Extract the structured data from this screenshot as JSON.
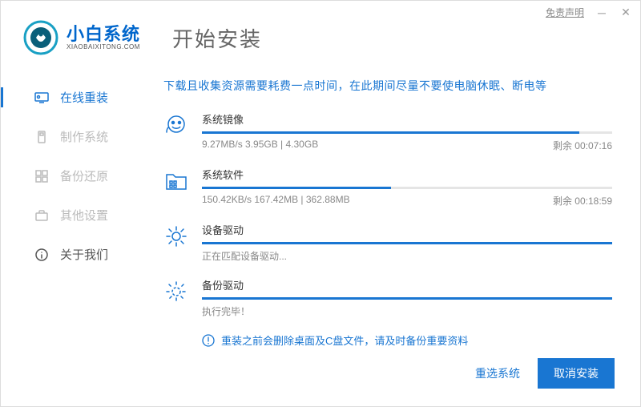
{
  "titlebar": {
    "disclaimer": "免责声明"
  },
  "brand": {
    "name": "小白系统",
    "url": "XIAOBAIXITONG.COM"
  },
  "page_title": "开始安装",
  "sidebar": {
    "items": [
      {
        "label": "在线重装"
      },
      {
        "label": "制作系统"
      },
      {
        "label": "备份还原"
      },
      {
        "label": "其他设置"
      },
      {
        "label": "关于我们"
      }
    ]
  },
  "notice": "下载且收集资源需要耗费一点时间，在此期间尽量不要使电脑休眠、断电等",
  "tasks": [
    {
      "title": "系统镜像",
      "progress": 92,
      "stats": "9.27MB/s 3.95GB | 4.30GB",
      "remaining": "剩余 00:07:16"
    },
    {
      "title": "系统软件",
      "progress": 46,
      "stats": "150.42KB/s 167.42MB | 362.88MB",
      "remaining": "剩余 00:18:59"
    },
    {
      "title": "设备驱动",
      "progress": 100,
      "stats": "正在匹配设备驱动...",
      "remaining": ""
    },
    {
      "title": "备份驱动",
      "progress": 100,
      "stats": "执行完毕！",
      "remaining": ""
    }
  ],
  "warning": "重装之前会删除桌面及C盘文件，请及时备份重要资料",
  "footer": {
    "reselect": "重选系统",
    "cancel": "取消安装"
  }
}
